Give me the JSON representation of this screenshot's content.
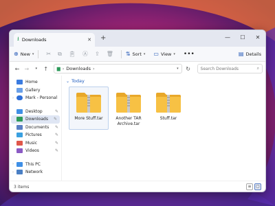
{
  "colors": {
    "accent": "#1d5bbf",
    "folder": "#f7c144",
    "selected": "#dfe6f4"
  },
  "tab": {
    "title": "Downloads",
    "icon": "download-icon"
  },
  "toolbar": {
    "new_label": "New",
    "sort_label": "Sort",
    "view_label": "View",
    "details_label": "Details"
  },
  "address": {
    "crumbs": [
      "Downloads"
    ],
    "search_placeholder": "Search Downloads"
  },
  "sidebar": {
    "top": [
      {
        "label": "Home",
        "icon": "home-icon",
        "color": "#3a7be0"
      },
      {
        "label": "Gallery",
        "icon": "gallery-icon",
        "color": "#6aa0e8"
      },
      {
        "label": "Mark - Personal",
        "icon": "cloud-icon",
        "color": "#2f6fd8"
      }
    ],
    "pinned": [
      {
        "label": "Desktop",
        "icon": "desktop-icon",
        "color": "#3f8fe6"
      },
      {
        "label": "Downloads",
        "icon": "download-icon",
        "color": "#2d9a5a"
      },
      {
        "label": "Documents",
        "icon": "documents-icon",
        "color": "#5a7fc4"
      },
      {
        "label": "Pictures",
        "icon": "pictures-icon",
        "color": "#3aa0e0"
      },
      {
        "label": "Music",
        "icon": "music-icon",
        "color": "#e0574a"
      },
      {
        "label": "Videos",
        "icon": "videos-icon",
        "color": "#8b5ac4"
      }
    ],
    "bottom": [
      {
        "label": "This PC",
        "icon": "pc-icon",
        "color": "#3f8fe6"
      },
      {
        "label": "Network",
        "icon": "network-icon",
        "color": "#4a7fc4"
      }
    ]
  },
  "content": {
    "group_label": "Today",
    "files": [
      {
        "name": "More Stuff.tar",
        "selected": true
      },
      {
        "name": "Another TAR Archive.tar",
        "selected": false
      },
      {
        "name": "Stuff.tar",
        "selected": false
      }
    ]
  },
  "status": {
    "item_count": "3 items"
  }
}
